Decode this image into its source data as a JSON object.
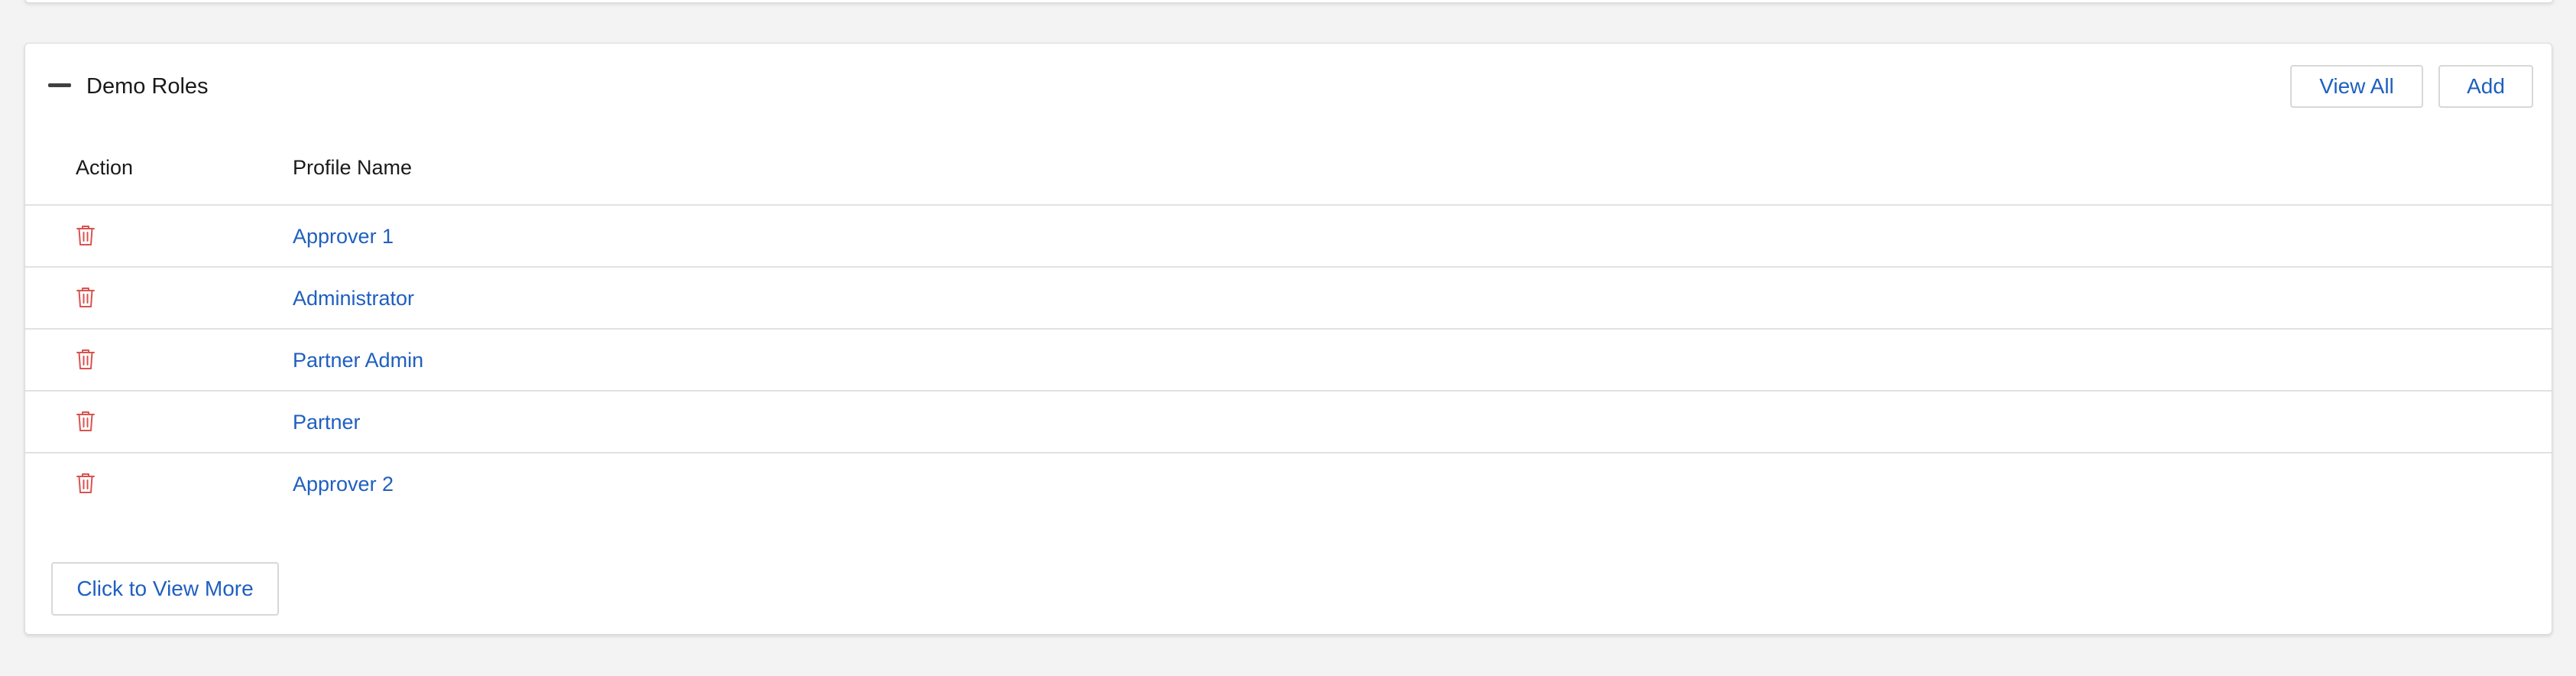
{
  "section": {
    "title": "Demo Roles",
    "view_all_label": "View All",
    "add_label": "Add",
    "view_more_label": "Click to View More"
  },
  "table": {
    "columns": [
      "Action",
      "Profile Name"
    ],
    "rows": [
      {
        "profile_name": "Approver 1",
        "action_icon": "trash-icon"
      },
      {
        "profile_name": "Administrator",
        "action_icon": "trash-icon"
      },
      {
        "profile_name": "Partner Admin",
        "action_icon": "trash-icon"
      },
      {
        "profile_name": "Partner",
        "action_icon": "trash-icon"
      },
      {
        "profile_name": "Approver 2",
        "action_icon": "trash-icon"
      }
    ]
  },
  "colors": {
    "link": "#1f5fc0",
    "delete_icon": "#d9534f",
    "border": "#dcdcdc",
    "background": "#f3f3f3"
  }
}
